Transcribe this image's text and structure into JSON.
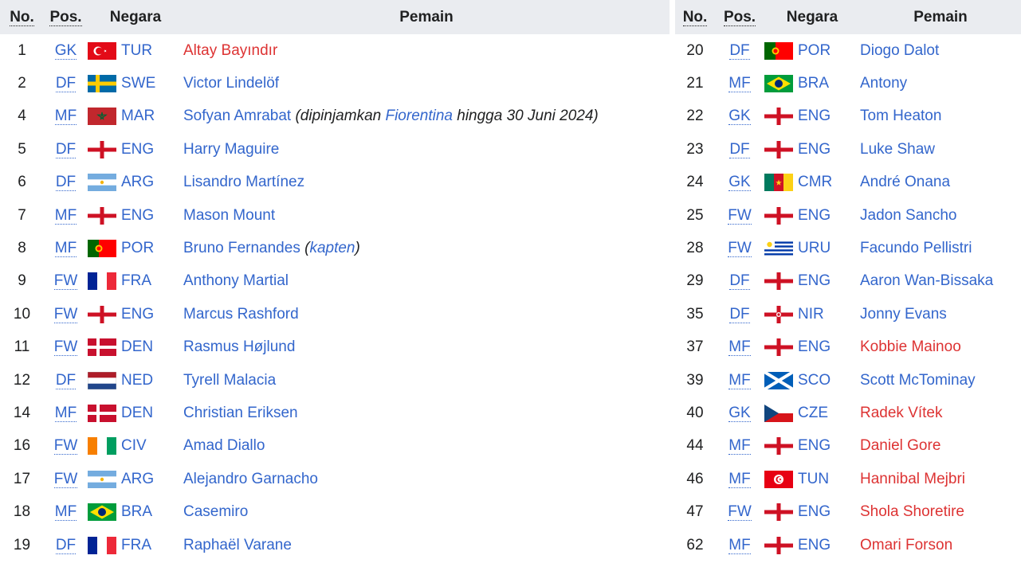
{
  "headers": {
    "no": "No.",
    "pos": "Pos.",
    "nation": "Negara",
    "player": "Pemain"
  },
  "left_rows": [
    {
      "no": "1",
      "pos": "GK",
      "code": "TUR",
      "flag": "turkey-flag-icon",
      "player": "Altay Bayındır",
      "link": "red"
    },
    {
      "no": "2",
      "pos": "DF",
      "code": "SWE",
      "flag": "sweden-flag-icon",
      "player": "Victor Lindelöf",
      "link": "blue"
    },
    {
      "no": "4",
      "pos": "MF",
      "code": "MAR",
      "flag": "morocco-flag-icon",
      "player": "Sofyan Amrabat",
      "link": "blue",
      "note_pre": "(dipinjamkan ",
      "note_link": "Fiorentina",
      "note_post": " hingga 30 Juni 2024)"
    },
    {
      "no": "5",
      "pos": "DF",
      "code": "ENG",
      "flag": "england-flag-icon",
      "player": "Harry Maguire",
      "link": "blue"
    },
    {
      "no": "6",
      "pos": "DF",
      "code": "ARG",
      "flag": "argentina-flag-icon",
      "player": "Lisandro Martínez",
      "link": "blue"
    },
    {
      "no": "7",
      "pos": "MF",
      "code": "ENG",
      "flag": "england-flag-icon",
      "player": "Mason Mount",
      "link": "blue"
    },
    {
      "no": "8",
      "pos": "MF",
      "code": "POR",
      "flag": "portugal-flag-icon",
      "player": "Bruno Fernandes",
      "link": "blue",
      "note_pre": "(",
      "note_link": "kapten",
      "note_post": ")"
    },
    {
      "no": "9",
      "pos": "FW",
      "code": "FRA",
      "flag": "france-flag-icon",
      "player": "Anthony Martial",
      "link": "blue"
    },
    {
      "no": "10",
      "pos": "FW",
      "code": "ENG",
      "flag": "england-flag-icon",
      "player": "Marcus Rashford",
      "link": "blue"
    },
    {
      "no": "11",
      "pos": "FW",
      "code": "DEN",
      "flag": "denmark-flag-icon",
      "player": "Rasmus Højlund",
      "link": "blue"
    },
    {
      "no": "12",
      "pos": "DF",
      "code": "NED",
      "flag": "netherlands-flag-icon",
      "player": "Tyrell Malacia",
      "link": "blue"
    },
    {
      "no": "14",
      "pos": "MF",
      "code": "DEN",
      "flag": "denmark-flag-icon",
      "player": "Christian Eriksen",
      "link": "blue"
    },
    {
      "no": "16",
      "pos": "FW",
      "code": "CIV",
      "flag": "ivory-coast-flag-icon",
      "player": "Amad Diallo",
      "link": "blue"
    },
    {
      "no": "17",
      "pos": "FW",
      "code": "ARG",
      "flag": "argentina-flag-icon",
      "player": "Alejandro Garnacho",
      "link": "blue"
    },
    {
      "no": "18",
      "pos": "MF",
      "code": "BRA",
      "flag": "brazil-flag-icon",
      "player": "Casemiro",
      "link": "blue"
    },
    {
      "no": "19",
      "pos": "DF",
      "code": "FRA",
      "flag": "france-flag-icon",
      "player": "Raphaël Varane",
      "link": "blue"
    }
  ],
  "right_rows": [
    {
      "no": "20",
      "pos": "DF",
      "code": "POR",
      "flag": "portugal-flag-icon",
      "player": "Diogo Dalot",
      "link": "blue"
    },
    {
      "no": "21",
      "pos": "MF",
      "code": "BRA",
      "flag": "brazil-flag-icon",
      "player": "Antony",
      "link": "blue"
    },
    {
      "no": "22",
      "pos": "GK",
      "code": "ENG",
      "flag": "england-flag-icon",
      "player": "Tom Heaton",
      "link": "blue"
    },
    {
      "no": "23",
      "pos": "DF",
      "code": "ENG",
      "flag": "england-flag-icon",
      "player": "Luke Shaw",
      "link": "blue"
    },
    {
      "no": "24",
      "pos": "GK",
      "code": "CMR",
      "flag": "cameroon-flag-icon",
      "player": "André Onana",
      "link": "blue"
    },
    {
      "no": "25",
      "pos": "FW",
      "code": "ENG",
      "flag": "england-flag-icon",
      "player": "Jadon Sancho",
      "link": "blue"
    },
    {
      "no": "28",
      "pos": "FW",
      "code": "URU",
      "flag": "uruguay-flag-icon",
      "player": "Facundo Pellistri",
      "link": "blue"
    },
    {
      "no": "29",
      "pos": "DF",
      "code": "ENG",
      "flag": "england-flag-icon",
      "player": "Aaron Wan-Bissaka",
      "link": "blue"
    },
    {
      "no": "35",
      "pos": "DF",
      "code": "NIR",
      "flag": "northern-ireland-flag-icon",
      "player": "Jonny Evans",
      "link": "blue"
    },
    {
      "no": "37",
      "pos": "MF",
      "code": "ENG",
      "flag": "england-flag-icon",
      "player": "Kobbie Mainoo",
      "link": "red"
    },
    {
      "no": "39",
      "pos": "MF",
      "code": "SCO",
      "flag": "scotland-flag-icon",
      "player": "Scott McTominay",
      "link": "blue"
    },
    {
      "no": "40",
      "pos": "GK",
      "code": "CZE",
      "flag": "czech-flag-icon",
      "player": "Radek Vítek",
      "link": "red"
    },
    {
      "no": "44",
      "pos": "MF",
      "code": "ENG",
      "flag": "england-flag-icon",
      "player": "Daniel Gore",
      "link": "red"
    },
    {
      "no": "46",
      "pos": "MF",
      "code": "TUN",
      "flag": "tunisia-flag-icon",
      "player": "Hannibal Mejbri",
      "link": "red"
    },
    {
      "no": "47",
      "pos": "FW",
      "code": "ENG",
      "flag": "england-flag-icon",
      "player": "Shola Shoretire",
      "link": "red"
    },
    {
      "no": "62",
      "pos": "MF",
      "code": "ENG",
      "flag": "england-flag-icon",
      "player": "Omari Forson",
      "link": "red"
    }
  ],
  "colors": {
    "link_blue": "#3366cc",
    "link_red": "#dd3333",
    "header_bg": "#eaecf0",
    "text": "#202122"
  }
}
